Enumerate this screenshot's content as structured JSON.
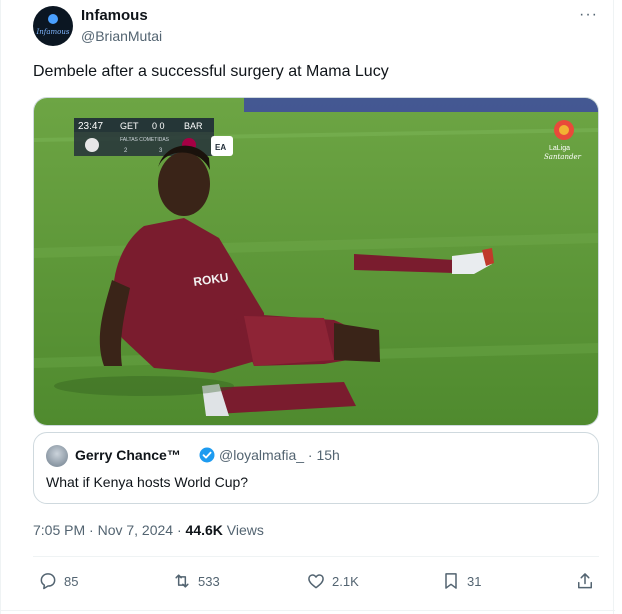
{
  "author": {
    "avatar_text": "Infamous",
    "name": "Infamous",
    "handle": "@BrianMutai"
  },
  "more_label": "···",
  "tweet": {
    "text": "Dembele after a successful surgery at Mama Lucy"
  },
  "media": {
    "scoreboard": {
      "time": "23:47",
      "home": "GET",
      "score": "0 0",
      "away": "BAR",
      "subtitle": "FALTAS COMETIDAS",
      "fouls_home": "2",
      "fouls_away": "3"
    },
    "jersey_text": "ROKU",
    "league_logo_line1": "LaLiga",
    "league_logo_line2": "Santander",
    "broadcaster_badge": "EA"
  },
  "quote": {
    "name": "Gerry Chance™",
    "handle": "@loyalmafia_ · 15h",
    "text": "What if Kenya hosts World Cup?"
  },
  "meta": {
    "time_date": "7:05 PM · Nov 7, 2024 · ",
    "views_count": "44.6K",
    "views_label": " Views"
  },
  "actions": {
    "replies": "85",
    "reposts": "533",
    "likes": "2.1K",
    "bookmarks": "31"
  },
  "colors": {
    "pitch": "#5f9a3a",
    "jersey": "#7a1c2e",
    "verified": "#1d9bf0",
    "muted": "#536471"
  }
}
